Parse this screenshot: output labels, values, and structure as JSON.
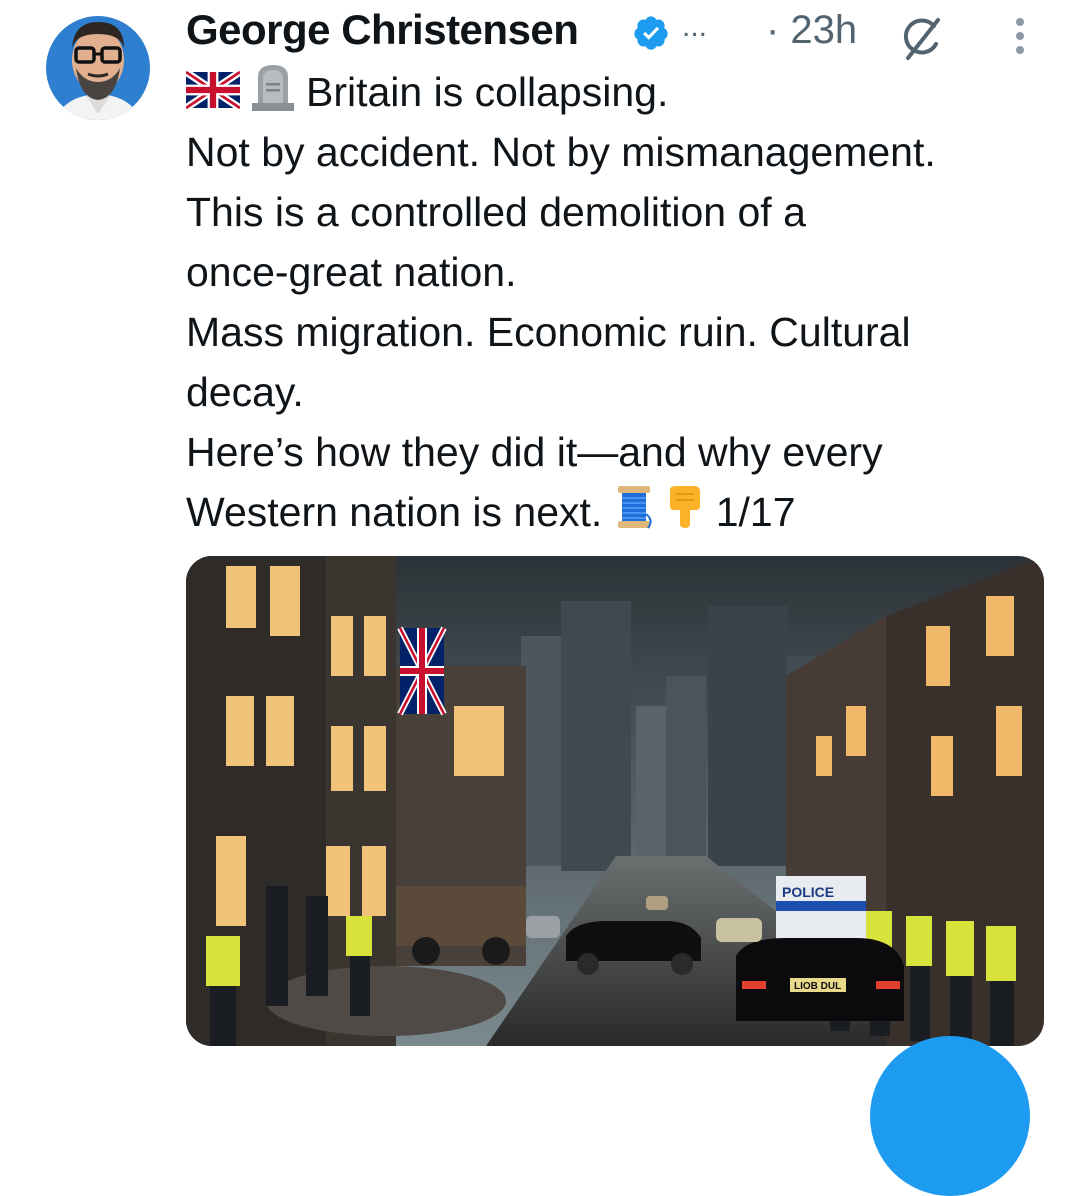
{
  "tweet": {
    "author_name": "George Christensen",
    "more_indicator": "...",
    "timestamp": "· 23h",
    "lines": [
      "Britain is collapsing.",
      "Not by accident. Not by mismanagement.",
      "This is a controlled demolition of a",
      "once-great nation.",
      "Mass migration. Economic ruin. Cultural",
      "decay.",
      "Here’s how they did it—and why every",
      "Western nation is next."
    ],
    "thread_counter": "1/17",
    "icons": {
      "verified": "verified-badge-icon",
      "grok": "grok-icon",
      "more": "more-vertical-icon",
      "flag": "uk-flag-emoji",
      "headstone": "headstone-emoji",
      "thread": "spool-of-thread-emoji",
      "point": "pointing-down-emoji"
    },
    "image_text": {
      "police_van": "POLICE",
      "number_plate": "LIOB DUL"
    }
  },
  "colors": {
    "accent": "#1d9bf0",
    "text": "#0f1419",
    "muted": "#536471"
  }
}
